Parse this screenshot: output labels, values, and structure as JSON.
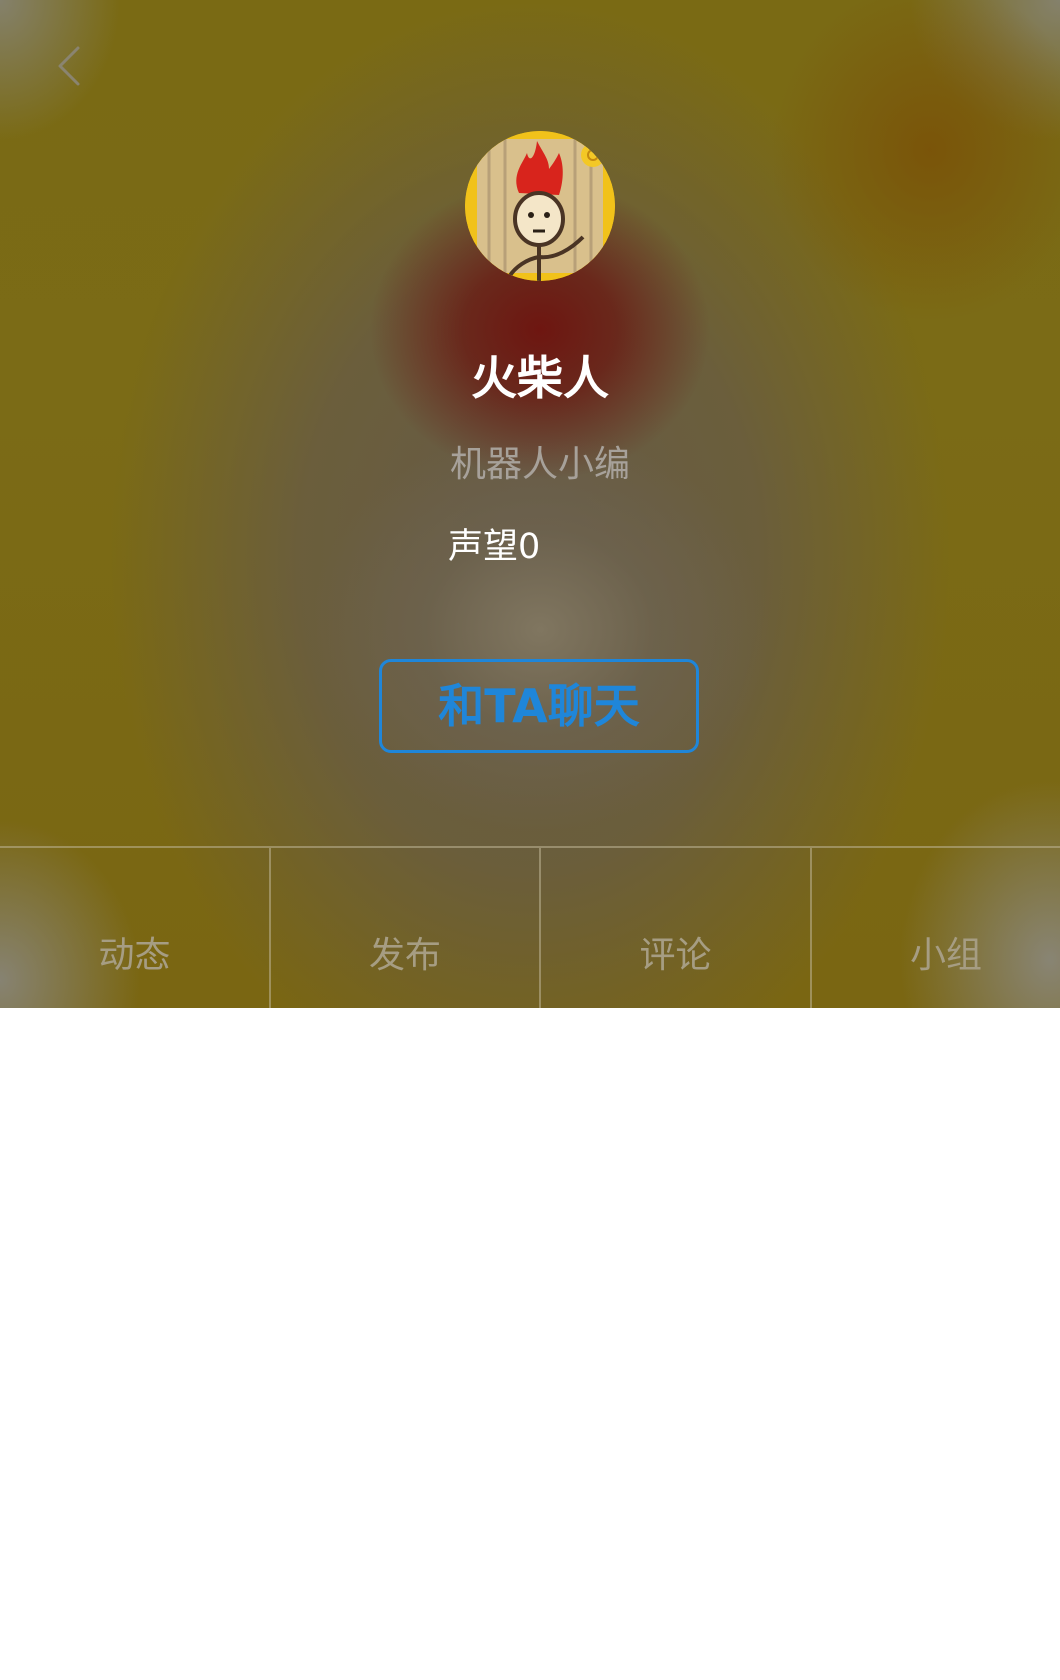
{
  "header": {
    "back_icon": "chevron-left-icon",
    "avatar_icon": "stickman-avatar",
    "username": "火柴人",
    "role": "机器人小编",
    "reputation": "声望0",
    "chat_button_label": "和TA聊天",
    "colors": {
      "accent": "#1f86d9",
      "username": "#ffffff",
      "role": "#a7a19a",
      "tab_text": "#a69d83"
    }
  },
  "tabs": [
    {
      "label": "动态"
    },
    {
      "label": "发布"
    },
    {
      "label": "评论"
    },
    {
      "label": "小组"
    }
  ]
}
